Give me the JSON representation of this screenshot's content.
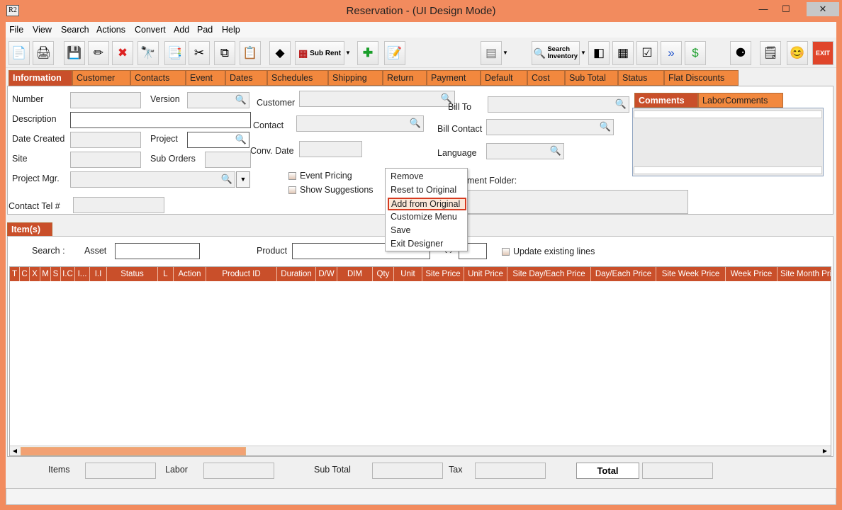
{
  "window": {
    "title": "Reservation - (UI Design Mode)",
    "app_icon": "R2",
    "minimize": "—",
    "maximize": "☐",
    "close": "✕"
  },
  "menu": [
    "File",
    "View",
    "Search",
    "Actions",
    "Convert",
    "Add",
    "Pad",
    "Help"
  ],
  "toolbar": {
    "sub_rent": "Sub Rent",
    "search_inventory_1": "Search",
    "search_inventory_2": "Inventory",
    "exit": "EXIT",
    "icons": [
      "new-document-icon",
      "print-icon",
      "save-icon",
      "edit-pencil-icon",
      "delete-x-icon",
      "binoculars-icon",
      "convert-icon",
      "cut-icon",
      "copy-icon",
      "paste-icon",
      "shapes-icon",
      "sub-rent-icon",
      "add-plus-icon",
      "notepad-icon",
      "calculator-icon",
      "search-inventory-icon",
      "eraser-icon",
      "grid-icon",
      "checklist-icon",
      "arrows-icon",
      "money-icon",
      "circles-icon",
      "notes-icon",
      "smiley-icon",
      "exit-icon"
    ]
  },
  "tabs": [
    "Information",
    "Customer",
    "Contacts",
    "Event",
    "Dates",
    "Schedules",
    "Shipping",
    "Return",
    "Payment",
    "Default",
    "Cost",
    "Sub Total",
    "Status",
    "Flat Discounts"
  ],
  "info": {
    "number": "Number",
    "version": "Version",
    "description": "Description",
    "date_created": "Date Created",
    "project": "Project",
    "site": "Site",
    "sub_orders": "Sub Orders",
    "project_mgr": "Project Mgr.",
    "contact_tel": "Contact Tel #",
    "customer": "Customer",
    "contact": "Contact",
    "conv_date": "Conv. Date",
    "event_pricing": "Event Pricing",
    "show_suggestions": "Show Suggestions",
    "bill_to": "Bill To",
    "bill_contact": "Bill Contact",
    "language": "Language",
    "document_folder": "ment Folder:"
  },
  "comments_tabs": [
    "Comments",
    "LaborComments"
  ],
  "items": {
    "tab": "Item(s)",
    "search": "Search :",
    "asset": "Asset",
    "product": "Product",
    "qty": "Qty",
    "update_existing": "Update existing lines",
    "columns": [
      "T",
      "C",
      "X",
      "M",
      "S",
      "I.C",
      "I...",
      "I.I",
      "Status",
      "L",
      "Action",
      "Product ID",
      "Duration",
      "D/W",
      "DIM",
      "Qty",
      "Unit",
      "Site Price",
      "Unit Price",
      "Site Day/Each Price",
      "Day/Each Price",
      "Site Week Price",
      "Week Price",
      "Site Month Pri"
    ]
  },
  "footer": {
    "items": "Items",
    "labor": "Labor",
    "sub_total": "Sub Total",
    "tax": "Tax",
    "total": "Total"
  },
  "context_menu": [
    "Remove",
    "Reset to Original",
    "Add from Original",
    "Customize Menu",
    "Save",
    "Exit Designer"
  ],
  "colors": {
    "accent": "#f2883e",
    "active_tab": "#c94f2a",
    "frame": "#f28b5e"
  }
}
